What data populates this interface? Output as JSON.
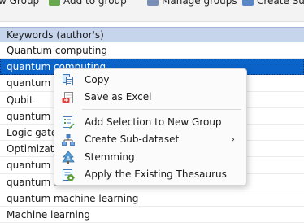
{
  "toolbar": {
    "items": [
      {
        "label": "w Group",
        "icon": "new-group-icon"
      },
      {
        "label": "Add to group",
        "icon": "add-to-group-icon"
      },
      {
        "label": "Manage groups",
        "icon": "manage-groups-icon"
      },
      {
        "label": "Create Su",
        "icon": "create-sub-icon"
      }
    ]
  },
  "table": {
    "column_header": "Keywords (author's)",
    "rows": [
      "Quantum computing",
      "quantum computing",
      "quantum c",
      "Qubit",
      "quantum c",
      "Logic gates",
      "Optimization",
      "quantum a",
      "quantum a",
      "quantum machine learning",
      "Machine learning"
    ],
    "selected_row_index": 1,
    "selection_color": "#0a63c9"
  },
  "context_menu": {
    "items": [
      {
        "label": "Copy",
        "icon": "copy-icon"
      },
      {
        "label": "Save as Excel",
        "icon": "excel-icon"
      },
      {
        "label": "Add Selection to New Group",
        "icon": "add-selection-icon"
      },
      {
        "label": "Create Sub-dataset",
        "icon": "sub-dataset-icon",
        "has_submenu": true,
        "submenu_glyph": "›"
      },
      {
        "label": "Stemming",
        "icon": "stemming-icon"
      },
      {
        "label": "Apply the Existing Thesaurus",
        "icon": "thesaurus-icon"
      }
    ]
  }
}
